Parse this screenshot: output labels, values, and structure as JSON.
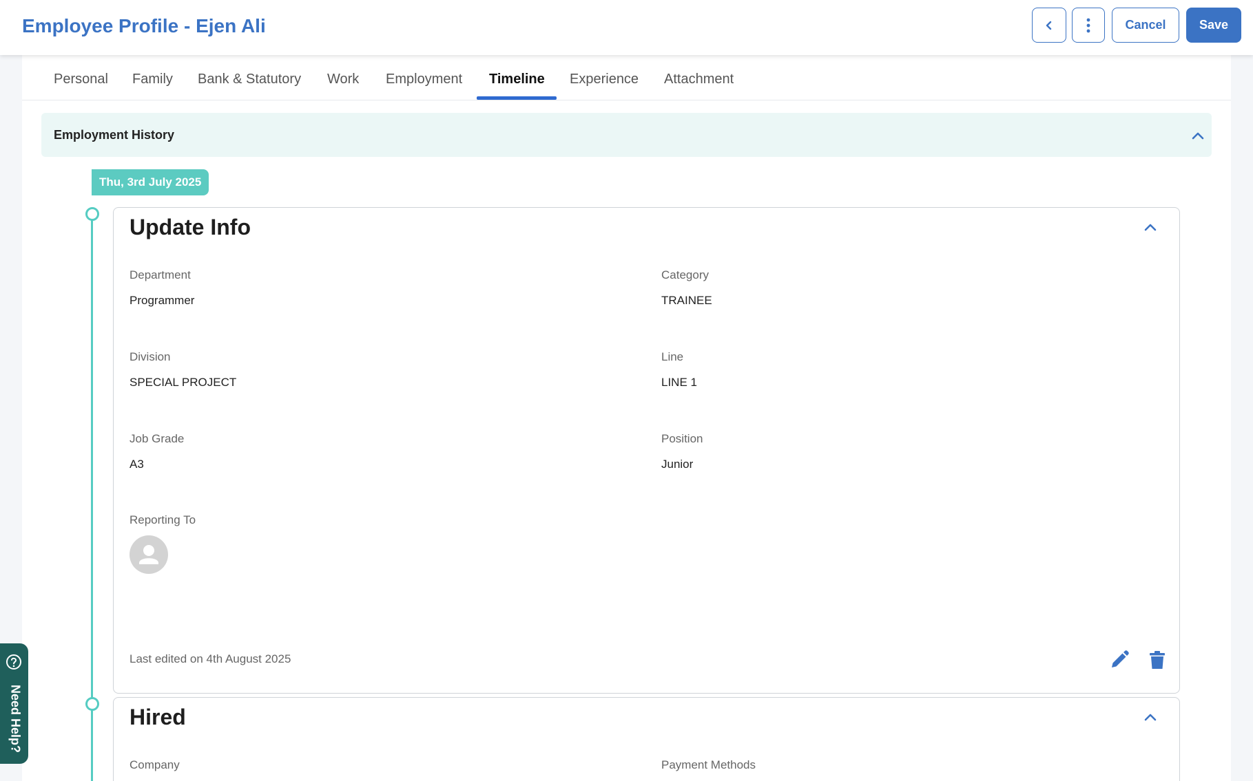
{
  "header": {
    "title": "Employee Profile - Ejen Ali",
    "cancel_label": "Cancel",
    "save_label": "Save",
    "icons": {
      "back": "chevron-left-icon",
      "more": "vertical-dots-icon"
    }
  },
  "tabs": [
    {
      "label": "Personal"
    },
    {
      "label": "Family"
    },
    {
      "label": "Bank & Statutory"
    },
    {
      "label": "Work"
    },
    {
      "label": "Employment"
    },
    {
      "label": "Timeline",
      "active": true
    },
    {
      "label": "Experience"
    },
    {
      "label": "Attachment"
    }
  ],
  "section": {
    "title": "Employment History"
  },
  "timeline": [
    {
      "date": "Thu, 3rd July 2025",
      "title": "Update Info",
      "fields": [
        {
          "label": "Department",
          "value": "Programmer"
        },
        {
          "label": "Category",
          "value": "TRAINEE"
        },
        {
          "label": "Division",
          "value": "SPECIAL PROJECT"
        },
        {
          "label": "Line",
          "value": "LINE 1"
        },
        {
          "label": "Job Grade",
          "value": "A3"
        },
        {
          "label": "Position",
          "value": "Junior"
        },
        {
          "label": "Reporting To",
          "value": ""
        }
      ],
      "last_edited": "Last edited on 4th August 2025"
    },
    {
      "title": "Hired",
      "fields": [
        {
          "label": "Company"
        },
        {
          "label": "Payment Methods"
        }
      ]
    }
  ],
  "help": {
    "label": "Need Help?"
  },
  "colors": {
    "primary": "#3b73c4",
    "teal": "#55ccc2",
    "section_bg": "#ebf7f6",
    "help_bg": "#1f5f5b"
  }
}
